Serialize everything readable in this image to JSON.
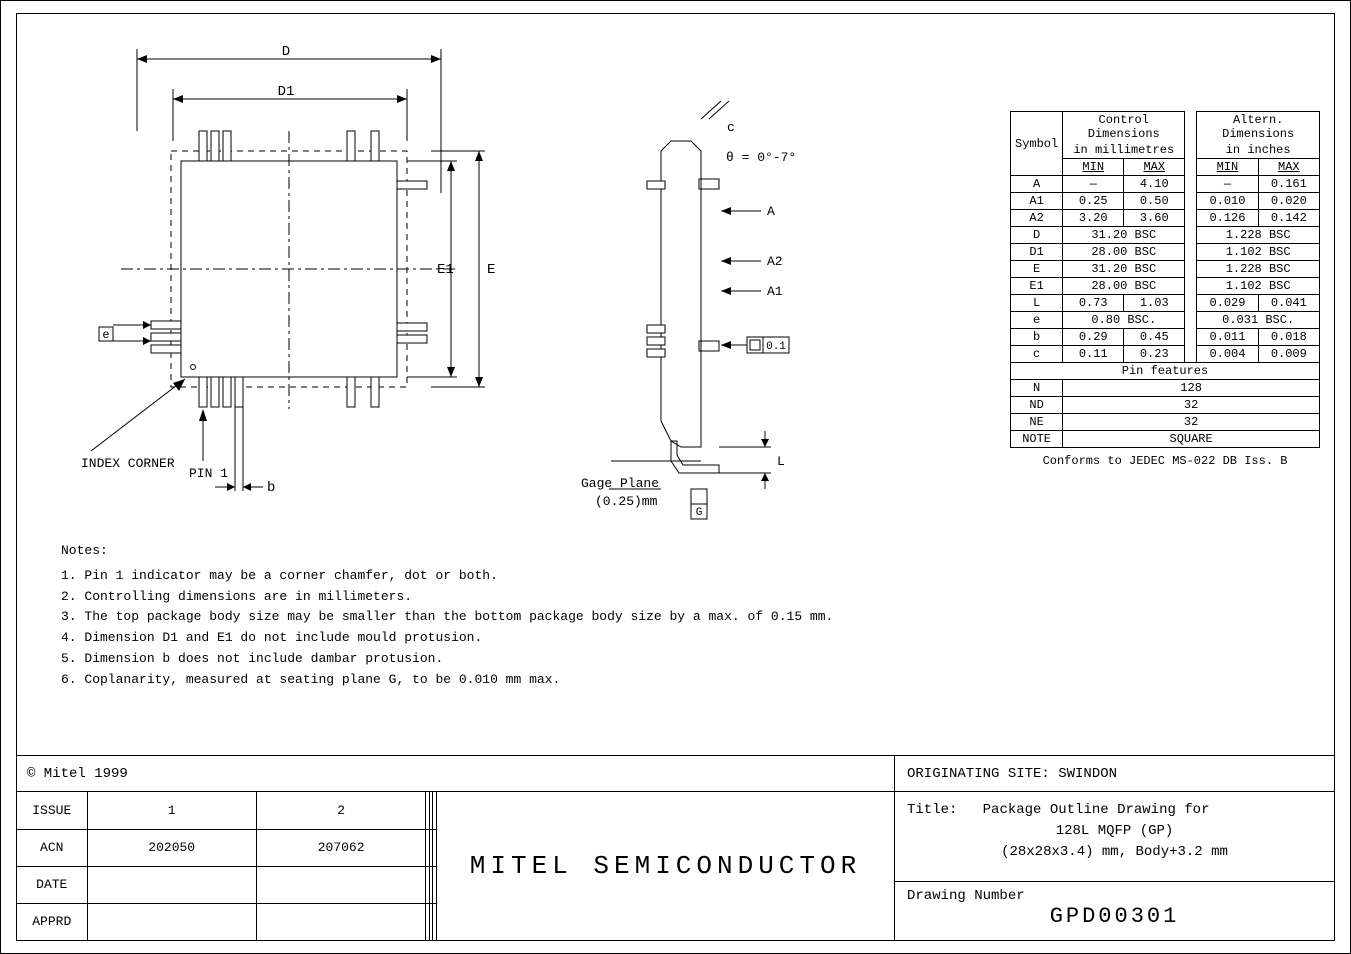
{
  "labels": {
    "D": "D",
    "D1": "D1",
    "E": "E",
    "E1": "E1",
    "e": "e",
    "b": "b",
    "c": "c",
    "A": "A",
    "A1": "A1",
    "A2": "A2",
    "L": "L",
    "theta": "θ = 0°-7°",
    "gage_plane": "Gage Plane",
    "gage_value": "(0.25)mm",
    "tol": "0.1",
    "index_corner": "INDEX CORNER",
    "pin1": "PIN 1"
  },
  "table": {
    "hdr_symbol": "Symbol",
    "hdr_control": "Control Dimensions",
    "hdr_control_units": "in millimetres",
    "hdr_altern": "Altern. Dimensions",
    "hdr_altern_units": "in inches",
    "hdr_min": "MIN",
    "hdr_max": "MAX",
    "rows": [
      {
        "sym": "A",
        "mm_min": "—",
        "mm_max": "4.10",
        "in_min": "—",
        "in_max": "0.161"
      },
      {
        "sym": "A1",
        "mm_min": "0.25",
        "mm_max": "0.50",
        "in_min": "0.010",
        "in_max": "0.020"
      },
      {
        "sym": "A2",
        "mm_min": "3.20",
        "mm_max": "3.60",
        "in_min": "0.126",
        "in_max": "0.142"
      },
      {
        "sym": "D",
        "mm_span": "31.20 BSC",
        "in_span": "1.228 BSC"
      },
      {
        "sym": "D1",
        "mm_span": "28.00 BSC",
        "in_span": "1.102 BSC"
      },
      {
        "sym": "E",
        "mm_span": "31.20 BSC",
        "in_span": "1.228 BSC"
      },
      {
        "sym": "E1",
        "mm_span": "28.00 BSC",
        "in_span": "1.102 BSC"
      },
      {
        "sym": "L",
        "mm_min": "0.73",
        "mm_max": "1.03",
        "in_min": "0.029",
        "in_max": "0.041"
      },
      {
        "sym": "e",
        "mm_span": "0.80 BSC.",
        "in_span": "0.031 BSC."
      },
      {
        "sym": "b",
        "mm_min": "0.29",
        "mm_max": "0.45",
        "in_min": "0.011",
        "in_max": "0.018"
      },
      {
        "sym": "c",
        "mm_min": "0.11",
        "mm_max": "0.23",
        "in_min": "0.004",
        "in_max": "0.009"
      }
    ],
    "pin_features": "Pin features",
    "N_lab": "N",
    "N_val": "128",
    "ND_lab": "ND",
    "ND_val": "32",
    "NE_lab": "NE",
    "NE_val": "32",
    "NOTE_lab": "NOTE",
    "NOTE_val": "SQUARE",
    "conforms": "Conforms to JEDEC MS-022 DB Iss. B"
  },
  "notes": {
    "title": "Notes:",
    "n1": "1. Pin 1 indicator may be a corner chamfer, dot or both.",
    "n2": "2. Controlling dimensions are in millimeters.",
    "n3": "3. The top package body size may be smaller than the bottom package body size by a max. of 0.15 mm.",
    "n4": "4. Dimension D1 and E1 do not include mould protusion.",
    "n5": "5. Dimension b does not include dambar protusion.",
    "n6": "6. Coplanarity, measured at seating plane G, to be 0.010 mm max."
  },
  "titleblock": {
    "copyright": "© Mitel 1999",
    "originating": "ORIGINATING SITE: SWINDON",
    "issue_lab": "ISSUE",
    "acn_lab": "ACN",
    "date_lab": "DATE",
    "apprd_lab": "APPRD",
    "issue_1": "1",
    "issue_2": "2",
    "acn_1": "202050",
    "acn_2": "207062",
    "company": "MITEL SEMICONDUCTOR",
    "title_lab": "Title:",
    "title_l1": "Package Outline Drawing for",
    "title_l2": "128L MQFP (GP)",
    "title_l3": "(28x28x3.4) mm, Body+3.2 mm",
    "dn_lab": "Drawing Number",
    "dn_val": "GPD00301"
  }
}
